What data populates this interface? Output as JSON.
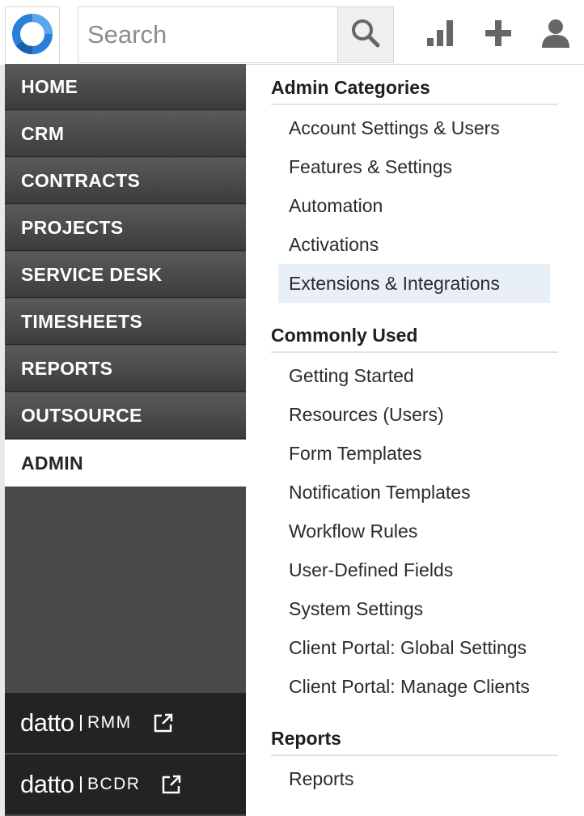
{
  "header": {
    "search_placeholder": "Search",
    "icons": [
      "logo-icon",
      "search-icon",
      "bar-chart-icon",
      "plus-icon",
      "user-icon"
    ]
  },
  "nav": {
    "items": [
      "HOME",
      "CRM",
      "CONTRACTS",
      "PROJECTS",
      "SERVICE DESK",
      "TIMESHEETS",
      "REPORTS",
      "OUTSOURCE",
      "ADMIN"
    ],
    "active": "ADMIN",
    "external_links": [
      {
        "brand": "datto",
        "product": "RMM"
      },
      {
        "brand": "datto",
        "product": "BCDR"
      }
    ]
  },
  "menu": {
    "sections": [
      {
        "title": "Admin Categories",
        "links": [
          "Account Settings & Users",
          "Features & Settings",
          "Automation",
          "Activations",
          "Extensions & Integrations"
        ]
      },
      {
        "title": "Commonly Used",
        "links": [
          "Getting Started",
          "Resources (Users)",
          "Form Templates",
          "Notification Templates",
          "Workflow Rules",
          "User-Defined Fields",
          "System Settings",
          "Client Portal: Global Settings",
          "Client Portal: Manage Clients"
        ]
      },
      {
        "title": "Reports",
        "links": [
          "Reports"
        ]
      }
    ],
    "highlighted": "Extensions & Integrations"
  },
  "colors": {
    "accent_blue": "#2b7fd8",
    "nav_dark": "#494949",
    "hover_bg": "#e8eff7"
  }
}
